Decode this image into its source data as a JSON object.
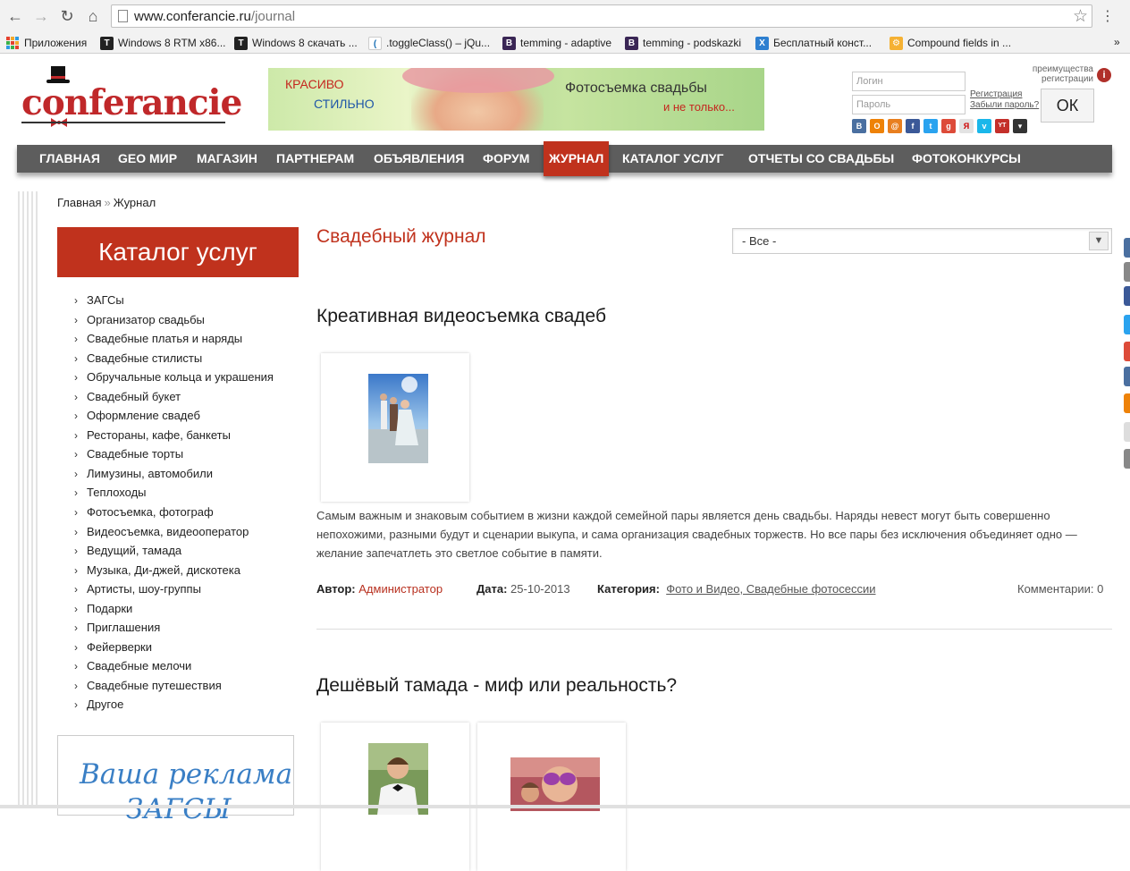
{
  "browser": {
    "url_host": "www.conferancie.ru",
    "url_path": "/journal",
    "bookmarks": [
      {
        "label": "Приложения",
        "icon": "apps-icon"
      },
      {
        "label": "Windows 8 RTM x86...",
        "icon": "t-favicon"
      },
      {
        "label": "Windows 8 скачать ...",
        "icon": "t-favicon"
      },
      {
        "label": ".toggleClass() – jQu...",
        "icon": "jquery-favicon"
      },
      {
        "label": "temming - adaptive",
        "icon": "b-favicon"
      },
      {
        "label": "temming - podskazki",
        "icon": "b-favicon"
      },
      {
        "label": "Бесплатный конст...",
        "icon": "x-favicon"
      },
      {
        "label": "Compound fields in ...",
        "icon": "gear-favicon"
      }
    ],
    "bookmarks_more": "»"
  },
  "header": {
    "logo_text": "conferancie",
    "banner": {
      "line1": "КРАСИВО",
      "line2": "СТИЛЬНО",
      "line3": "Фотосъемка свадьбы",
      "line4": "и не только..."
    },
    "login_placeholder": "Логин",
    "password_placeholder": "Пароль",
    "register_link": "Регистрация",
    "forgot_link": "Забыли пароль?",
    "ok_label": "ОК",
    "advantages_line1": "преимущества",
    "advantages_line2": "регистрации",
    "info_icon": "i",
    "socials": [
      {
        "name": "vkontakte",
        "glyph": "В",
        "color": "#4a6fa0"
      },
      {
        "name": "odnoklassniki",
        "glyph": "О",
        "color": "#ee8208"
      },
      {
        "name": "mailru",
        "glyph": "@",
        "color": "#e87f1f"
      },
      {
        "name": "facebook",
        "glyph": "f",
        "color": "#3b5998"
      },
      {
        "name": "twitter",
        "glyph": "t",
        "color": "#2aa3ef"
      },
      {
        "name": "google",
        "glyph": "g",
        "color": "#dd4b39"
      },
      {
        "name": "yandex",
        "glyph": "Я",
        "color": "#e3e3e3"
      },
      {
        "name": "vimeo",
        "glyph": "v",
        "color": "#1ab7ea"
      },
      {
        "name": "youtube",
        "glyph": "YT",
        "color": "#c4302b"
      },
      {
        "name": "more",
        "glyph": "▾",
        "color": "#333333"
      }
    ]
  },
  "menu": [
    {
      "label": "ГЛАВНАЯ"
    },
    {
      "label": "GEO МИР"
    },
    {
      "label": "МАГАЗИН"
    },
    {
      "label": "ПАРТНЕРАМ"
    },
    {
      "label": "ОБЪЯВЛЕНИЯ"
    },
    {
      "label": "ФОРУМ"
    },
    {
      "label": "ЖУРНАЛ",
      "active": true
    },
    {
      "label": "КАТАЛОГ УСЛУГ"
    },
    {
      "label": "ОТЧЕТЫ СО СВАДЬБЫ"
    },
    {
      "label": "ФОТОКОНКУРСЫ"
    }
  ],
  "breadcrumb": {
    "home": "Главная",
    "sep": "»",
    "current": "Журнал"
  },
  "sidebar": {
    "catalog_title": "Каталог услуг",
    "items": [
      "ЗАГСы",
      "Организатор свадьбы",
      "Свадебные платья и наряды",
      "Свадебные стилисты",
      "Обручальные кольца и украшения",
      "Свадебный букет",
      "Оформление свадеб",
      "Рестораны, кафе, банкеты",
      "Свадебные торты",
      "Лимузины, автомобили",
      "Теплоходы",
      "Фотосъемка, фотограф",
      "Видеосъемка, видеооператор",
      "Ведущий, тамада",
      "Музыка, Ди-джей, дискотека",
      "Артисты, шоу-группы",
      "Подарки",
      "Приглашения",
      "Фейерверки",
      "Свадебные мелочи",
      "Свадебные путешествия",
      "Другое"
    ],
    "ad_line1": "Ваша реклама",
    "ad_line2": "ЗАГСЫ"
  },
  "main": {
    "title": "Свадебный журнал",
    "filter_value": "- Все -",
    "articles": [
      {
        "title": "Креативная видеосъемка свадеб",
        "text": "Самым важным и знаковым событием в жизни каждой семейной пары является день свадьбы. Наряды невест могут быть совершенно непохожими, разными будут и сценарии выкупа, и сама организация свадебных торжеств. Но все пары без исключения объединяет одно — желание запечатлеть это светлое событие в памяти.",
        "author_label": "Автор:",
        "author": "Администратор",
        "date_label": "Дата:",
        "date": "25-10-2013",
        "category_label": "Категория:",
        "category": "Фото и Видео, Свадебные фотосессии",
        "comments": "Комментарии: 0"
      },
      {
        "title": "Дешёвый тамада - миф или реальность?"
      }
    ]
  },
  "colors": {
    "brand_red": "#c0321d",
    "menu_bg": "#5d5d5d",
    "link_red": "#b8301f"
  }
}
